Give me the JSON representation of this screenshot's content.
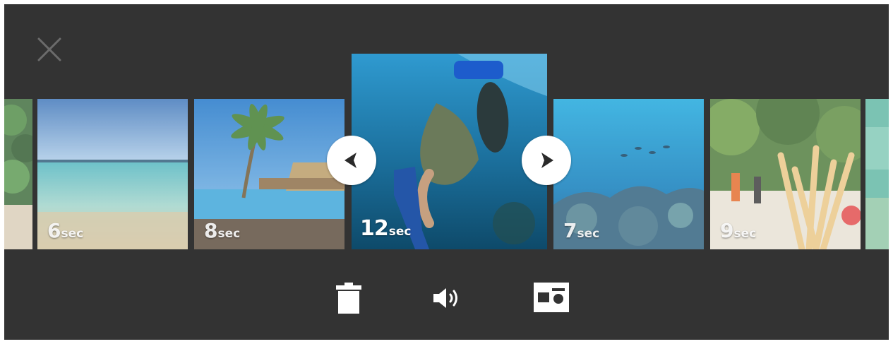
{
  "controls": {
    "close_icon": "close-icon",
    "prev_icon": "chevron-left-icon",
    "next_icon": "chevron-right-icon"
  },
  "clips": [
    {
      "id": "clip-1",
      "scene": "jungle",
      "duration": "",
      "unit": ""
    },
    {
      "id": "clip-2",
      "scene": "beach-shore",
      "duration": "6",
      "unit": "sec"
    },
    {
      "id": "clip-3",
      "scene": "palm-bungalows",
      "duration": "8",
      "unit": "sec"
    },
    {
      "id": "clip-4",
      "scene": "snorkeler",
      "duration": "12",
      "unit": "sec",
      "selected": true
    },
    {
      "id": "clip-5",
      "scene": "reef",
      "duration": "7",
      "unit": "sec"
    },
    {
      "id": "clip-6",
      "scene": "island-path",
      "duration": "9",
      "unit": "sec"
    },
    {
      "id": "clip-7",
      "scene": "lagoon",
      "duration": "",
      "unit": ""
    }
  ],
  "toolbar": {
    "delete_icon": "trash-icon",
    "volume_icon": "volume-icon",
    "layout_icon": "layout-icon"
  },
  "colors": {
    "background": "#333333",
    "selected_clip_accent": "#ffffff"
  }
}
